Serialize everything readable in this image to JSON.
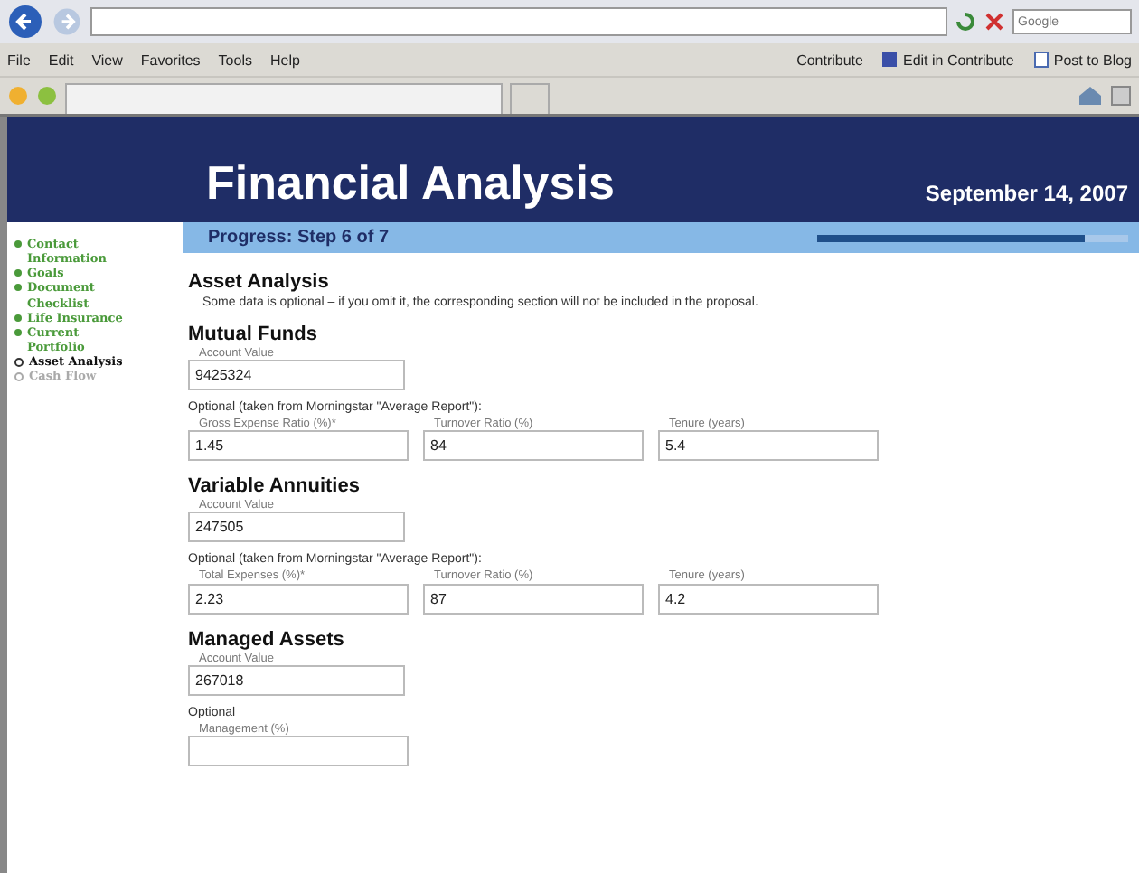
{
  "browser": {
    "search": {
      "placeholder": "Google"
    },
    "menu": [
      "File",
      "Edit",
      "View",
      "Favorites",
      "Tools",
      "Help"
    ],
    "toolbar_links": [
      {
        "label": "Contribute",
        "kind": "text"
      },
      {
        "label": "Edit in Contribute",
        "kind": "edit"
      },
      {
        "label": "Post to Blog",
        "kind": "blog"
      }
    ]
  },
  "header": {
    "title": "Financial Analysis",
    "date": "September 14, 2007"
  },
  "progress": {
    "label": "Progress: Step 6 of 7",
    "level": 0.86
  },
  "sidebar": {
    "items": [
      {
        "label": "Contact Information",
        "kind": "done"
      },
      {
        "label": "Goals",
        "kind": "done"
      },
      {
        "label": "Document Checklist",
        "kind": "done"
      },
      {
        "label": "Life Insurance",
        "kind": "done"
      },
      {
        "label": "Current Portfolio",
        "kind": "done"
      },
      {
        "label": "Asset Analysis",
        "kind": "current"
      },
      {
        "label": "Cash Flow",
        "kind": "pending"
      }
    ]
  },
  "section": {
    "title": "Asset Analysis",
    "note": "Some data is optional – if you omit it, the corresponding section will not be included in the proposal."
  },
  "groups": [
    {
      "title": "Mutual Funds",
      "account_label": "Account Value",
      "account_value": "9425324",
      "optional_label": "Optional (taken from Morningstar \"Average Report\"):",
      "fields": [
        {
          "label": "Gross Expense Ratio (%)*",
          "value": "1.45"
        },
        {
          "label": "Turnover Ratio (%)",
          "value": "84"
        },
        {
          "label": "Tenure (years)",
          "value": "5.4"
        }
      ]
    },
    {
      "title": "Variable Annuities",
      "account_label": "Account Value",
      "account_value": "247505",
      "optional_label": "Optional (taken from Morningstar \"Average Report\"):",
      "fields": [
        {
          "label": "Total Expenses (%)*",
          "value": "2.23"
        },
        {
          "label": "Turnover Ratio (%)",
          "value": "87"
        },
        {
          "label": "Tenure (years)",
          "value": "4.2"
        }
      ]
    },
    {
      "title": "Managed Assets",
      "account_label": "Account Value",
      "account_value": "267018",
      "optional_label": "Optional",
      "fields": [
        {
          "label": "Management (%)"
        }
      ]
    }
  ]
}
